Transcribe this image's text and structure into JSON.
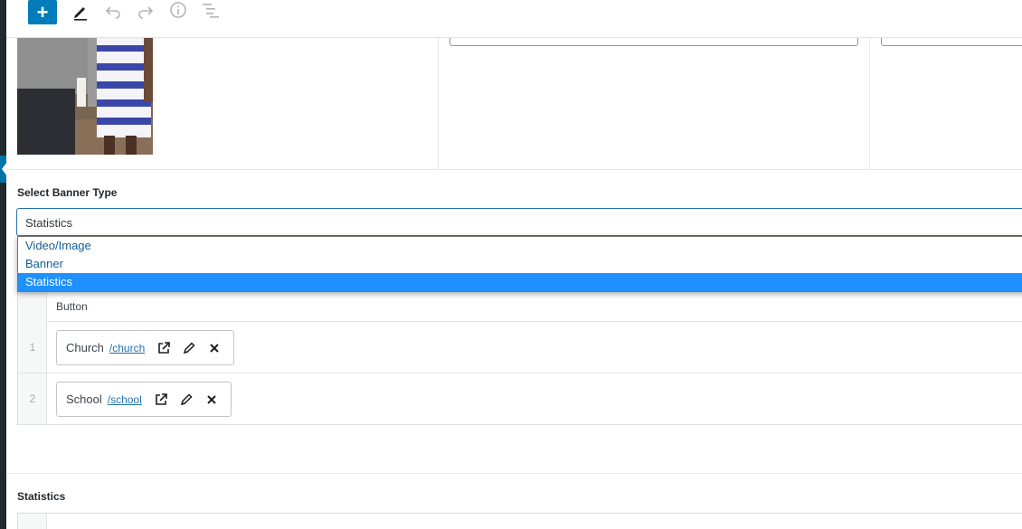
{
  "toolbar": {
    "add_label": "+",
    "icons": [
      "plus-icon",
      "pencil-icon",
      "undo-icon",
      "redo-icon",
      "info-icon",
      "outline-icon"
    ]
  },
  "banner_type": {
    "label": "Select Banner Type",
    "selected": "Statistics",
    "options": [
      "Video/Image",
      "Banner",
      "Statistics"
    ]
  },
  "buttons_table": {
    "header": "Button",
    "rows": [
      {
        "index": "1",
        "title": "Church",
        "url": "/church"
      },
      {
        "index": "2",
        "title": "School",
        "url": "/school"
      }
    ]
  },
  "statistics": {
    "label": "Statistics"
  },
  "colors": {
    "accent": "#007cba",
    "selected_option": "#1e90ff",
    "link": "#2271b1"
  }
}
